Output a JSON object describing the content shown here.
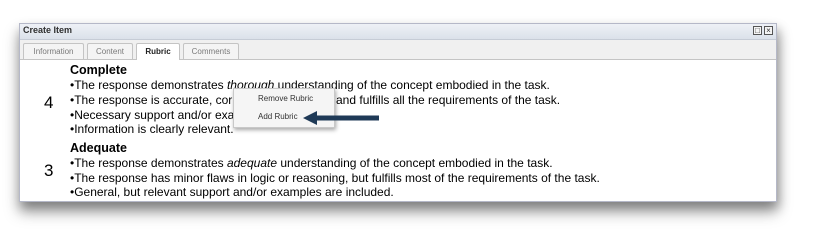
{
  "window": {
    "title": "Create Item",
    "buttons": {
      "restore": "□",
      "close": "×"
    }
  },
  "tabs": [
    {
      "label": "Information",
      "active": false
    },
    {
      "label": "Content",
      "active": false
    },
    {
      "label": "Rubric",
      "active": true
    },
    {
      "label": "Comments",
      "active": false
    }
  ],
  "rubric": {
    "levels": [
      {
        "score": "4",
        "heading": "Complete",
        "lines": {
          "l1_pre": "•The response demonstrates ",
          "l1_em": "thorough",
          "l1_post": " understanding of the concept embodied in the task.",
          "l2_pre": "•The response is accurate, cor",
          "l2_post": "and fulfills all the requirements of the task.",
          "l3": "•Necessary support and/or exa",
          "l4": "•Information is clearly relevant."
        }
      },
      {
        "score": "3",
        "heading": "Adequate",
        "lines": {
          "l1_pre": "•The response demonstrates ",
          "l1_em": "adequate",
          "l1_post": " understanding of the concept embodied in the task.",
          "l2": "•The response has minor flaws in logic or reasoning, but fulfills most of the requirements of the task.",
          "l3": "•General, but relevant support and/or examples are included."
        }
      }
    ]
  },
  "context_menu": {
    "items": [
      "Remove Rubric",
      "Add Rubric"
    ]
  },
  "colors": {
    "arrow": "#1f3a57",
    "border": "#b5b8c8"
  }
}
